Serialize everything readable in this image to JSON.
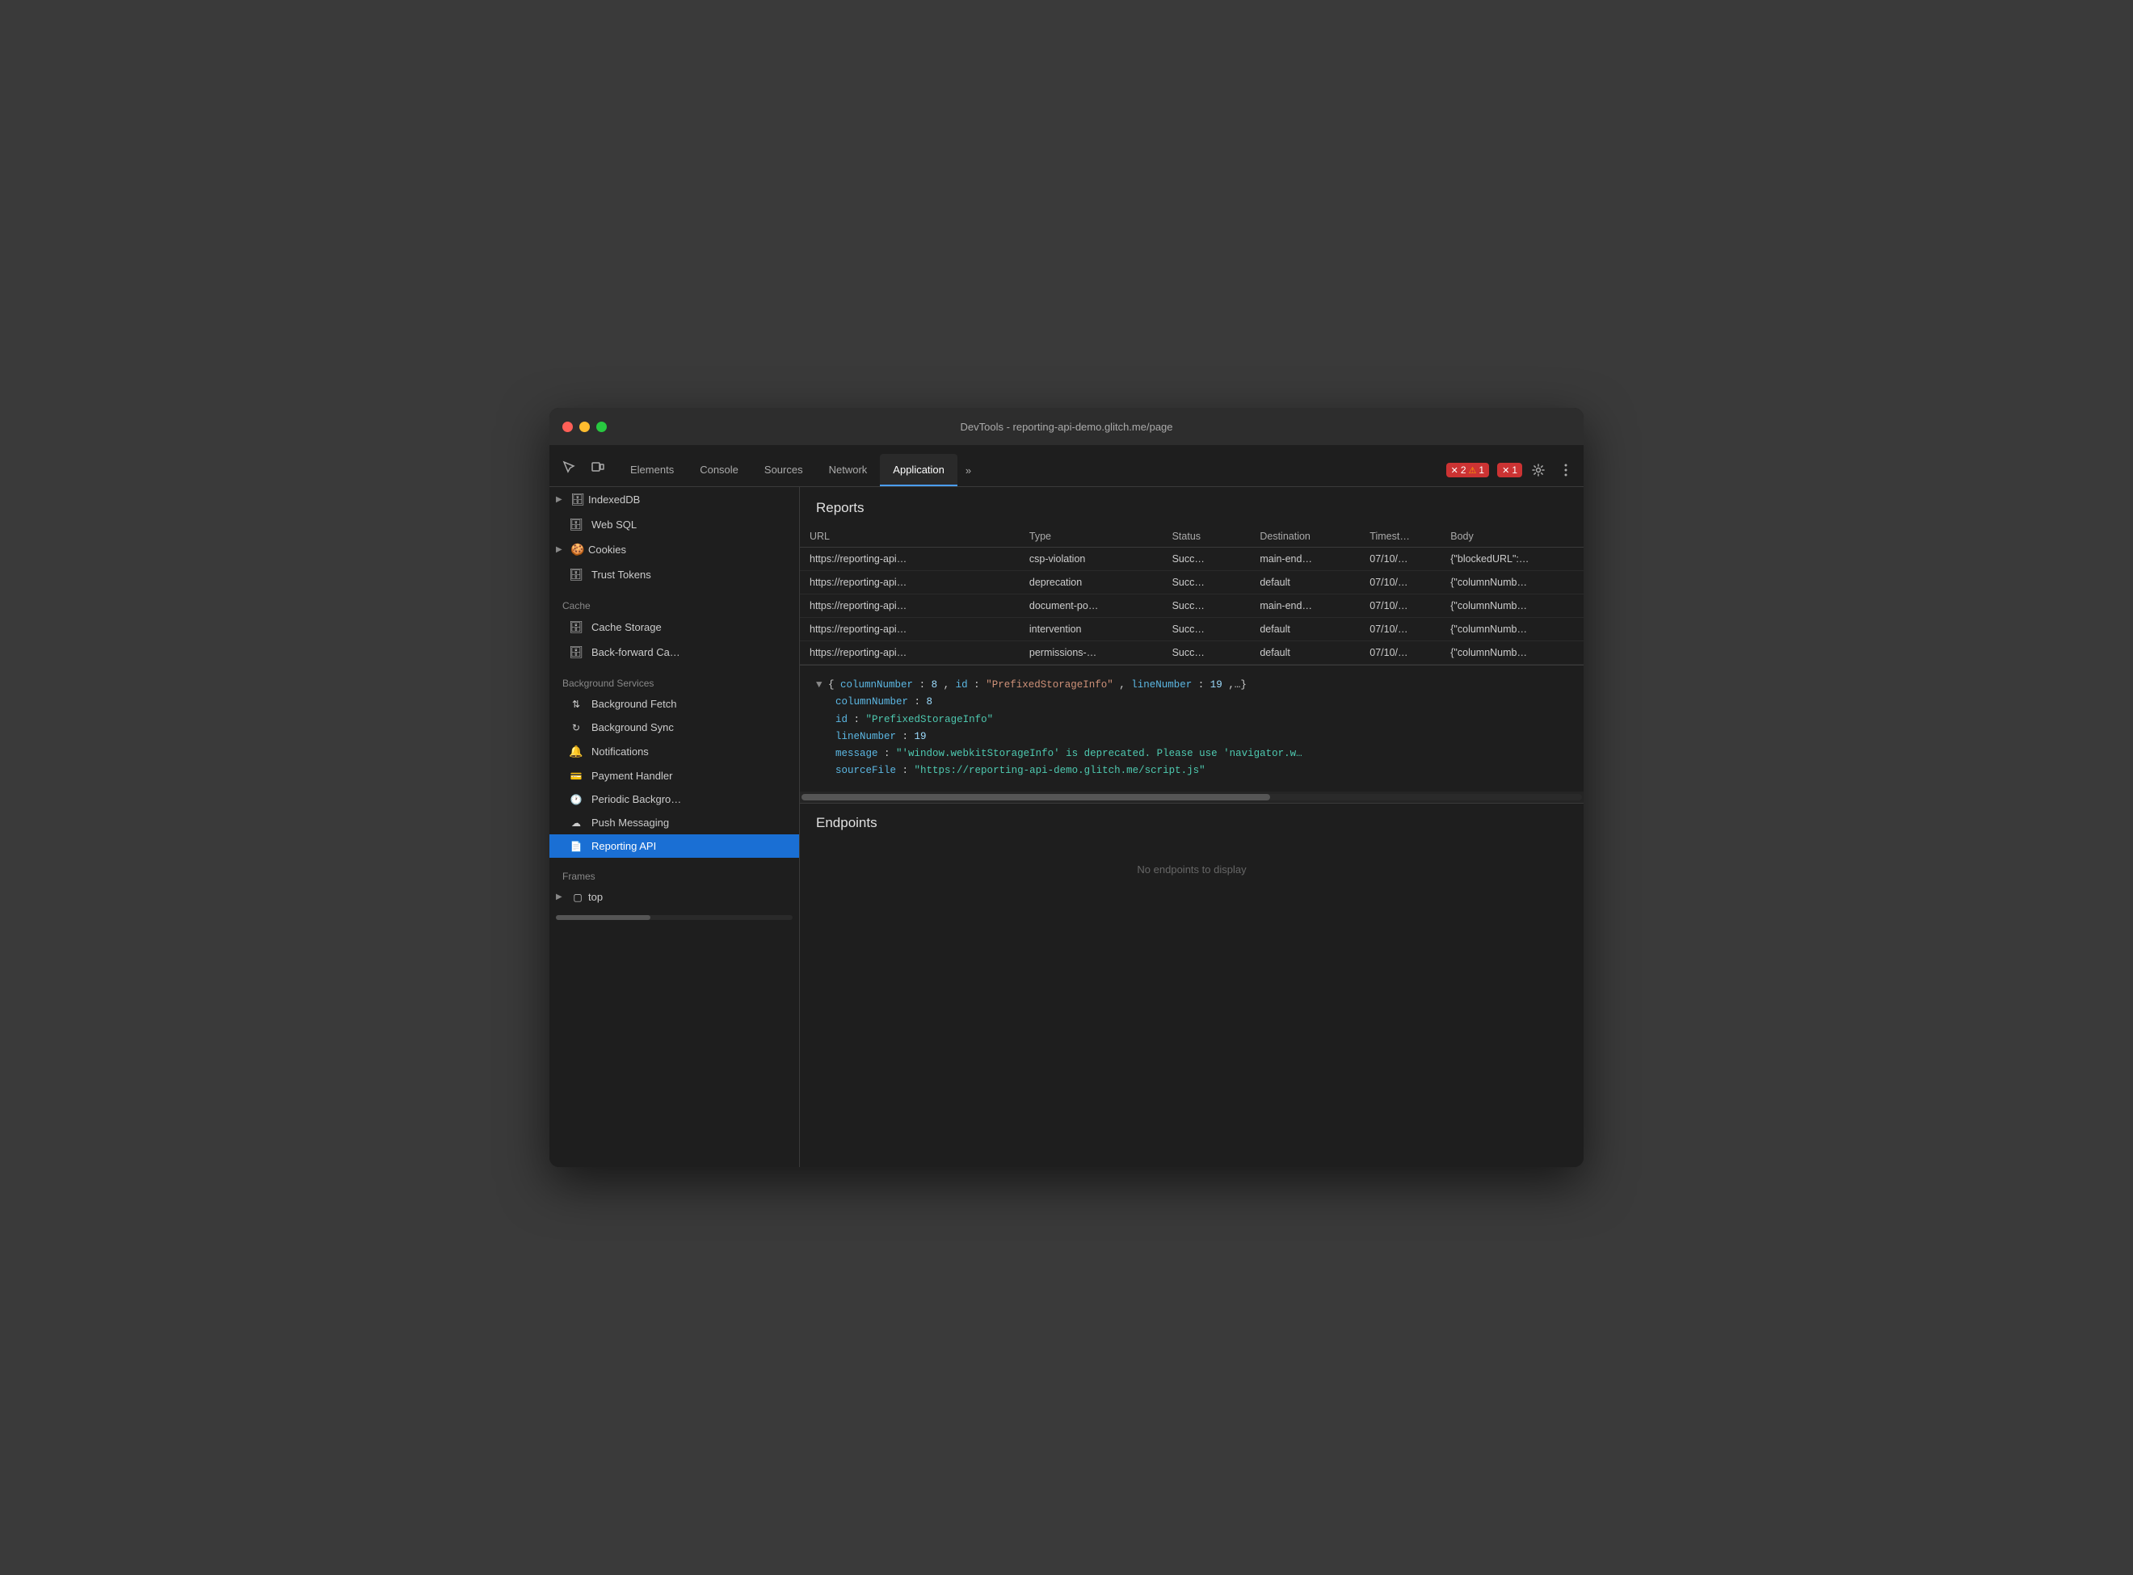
{
  "window": {
    "title": "DevTools - reporting-api-demo.glitch.me/page"
  },
  "tabs": {
    "items": [
      {
        "label": "Elements",
        "active": false
      },
      {
        "label": "Console",
        "active": false
      },
      {
        "label": "Sources",
        "active": false
      },
      {
        "label": "Network",
        "active": false
      },
      {
        "label": "Application",
        "active": true
      }
    ],
    "more_label": "»",
    "error_count": "2",
    "warn_count": "1",
    "error2_count": "1"
  },
  "sidebar": {
    "sections": {
      "cache_label": "Cache",
      "bg_services_label": "Background Services",
      "frames_label": "Frames"
    },
    "items": {
      "indexed_db": "IndexedDB",
      "web_sql": "Web SQL",
      "cookies": "Cookies",
      "trust_tokens": "Trust Tokens",
      "cache_storage": "Cache Storage",
      "back_forward": "Back-forward Ca…",
      "bg_fetch": "Background Fetch",
      "bg_sync": "Background Sync",
      "notifications": "Notifications",
      "payment_handler": "Payment Handler",
      "periodic_bg": "Periodic Backgro…",
      "push_messaging": "Push Messaging",
      "reporting_api": "Reporting API",
      "frames_top": "top"
    }
  },
  "reports": {
    "section_title": "Reports",
    "columns": {
      "url": "URL",
      "type": "Type",
      "status": "Status",
      "destination": "Destination",
      "timestamp": "Timest…",
      "body": "Body"
    },
    "rows": [
      {
        "url": "https://reporting-api…",
        "type": "csp-violation",
        "status": "Succ…",
        "destination": "main-end…",
        "timestamp": "07/10/…",
        "body": "{\"blockedURL\":…"
      },
      {
        "url": "https://reporting-api…",
        "type": "deprecation",
        "status": "Succ…",
        "destination": "default",
        "timestamp": "07/10/…",
        "body": "{\"columnNumb…"
      },
      {
        "url": "https://reporting-api…",
        "type": "document-po…",
        "status": "Succ…",
        "destination": "main-end…",
        "timestamp": "07/10/…",
        "body": "{\"columnNumb…"
      },
      {
        "url": "https://reporting-api…",
        "type": "intervention",
        "status": "Succ…",
        "destination": "default",
        "timestamp": "07/10/…",
        "body": "{\"columnNumb…"
      },
      {
        "url": "https://reporting-api…",
        "type": "permissions-…",
        "status": "Succ…",
        "destination": "default",
        "timestamp": "07/10/…",
        "body": "{\"columnNumb…"
      }
    ]
  },
  "detail": {
    "summary_line": "▼ {columnNumber: 8, id: \"PrefixedStorageInfo\", lineNumber: 19,…}",
    "fields": [
      {
        "key": "columnNumber",
        "value": "8",
        "type": "number"
      },
      {
        "key": "id",
        "value": "\"PrefixedStorageInfo\"",
        "type": "string"
      },
      {
        "key": "lineNumber",
        "value": "19",
        "type": "number"
      },
      {
        "key": "message",
        "value": "\"'window.webkitStorageInfo' is deprecated. Please use 'navigator.w…",
        "type": "string_long"
      },
      {
        "key": "sourceFile",
        "value": "\"https://reporting-api-demo.glitch.me/script.js\"",
        "type": "string"
      }
    ]
  },
  "endpoints": {
    "section_title": "Endpoints",
    "empty_message": "No endpoints to display"
  }
}
